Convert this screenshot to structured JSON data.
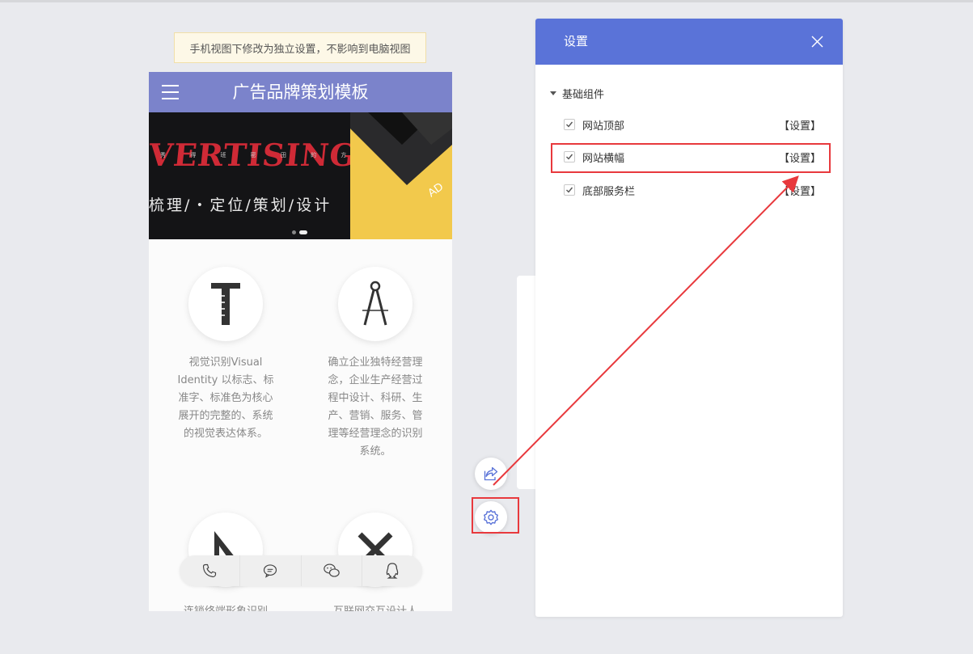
{
  "notice": "手机视图下修改为独立设置，不影响到电脑视图",
  "mobile": {
    "title": "广告品牌策划模板",
    "banner": {
      "headline": "VERTISING",
      "small_text": "秀 得 班 密 田 的 方 向",
      "slogan": "梳理/・定位/策划/设计",
      "active_slide": 2,
      "slide_count": 2
    },
    "features": [
      {
        "icon": "t-square-icon",
        "text": "视觉识别Visual Identity 以标志、标准字、标准色为核心展开的完整的、系统的视觉表达体系。"
      },
      {
        "icon": "compass-icon",
        "text": "确立企业独特经营理念，企业生产经营过程中设计、科研、生产、营销、服务、管理等经营理念的识别系统。"
      },
      {
        "icon": "triangle-ruler-icon",
        "text": "连锁终端形象识别"
      },
      {
        "icon": "pencil-ruler-icon",
        "text": "互联网交互设计人"
      }
    ],
    "bottom_bar": [
      "phone-icon",
      "chat-icon",
      "wechat-icon",
      "qq-icon"
    ]
  },
  "settings": {
    "title": "设置",
    "group_label": "基础组件",
    "items": [
      {
        "label": "网站顶部",
        "action": "【设置】",
        "checked": true
      },
      {
        "label": "网站横幅",
        "action": "【设置】",
        "checked": true
      },
      {
        "label": "底部服务栏",
        "action": "【设置】",
        "checked": true
      }
    ]
  },
  "colors": {
    "panel_header": "#5a73d8",
    "mobile_header": "#7b83cb",
    "highlight": "#e8393d",
    "notice_bg": "#fdf8e7"
  }
}
